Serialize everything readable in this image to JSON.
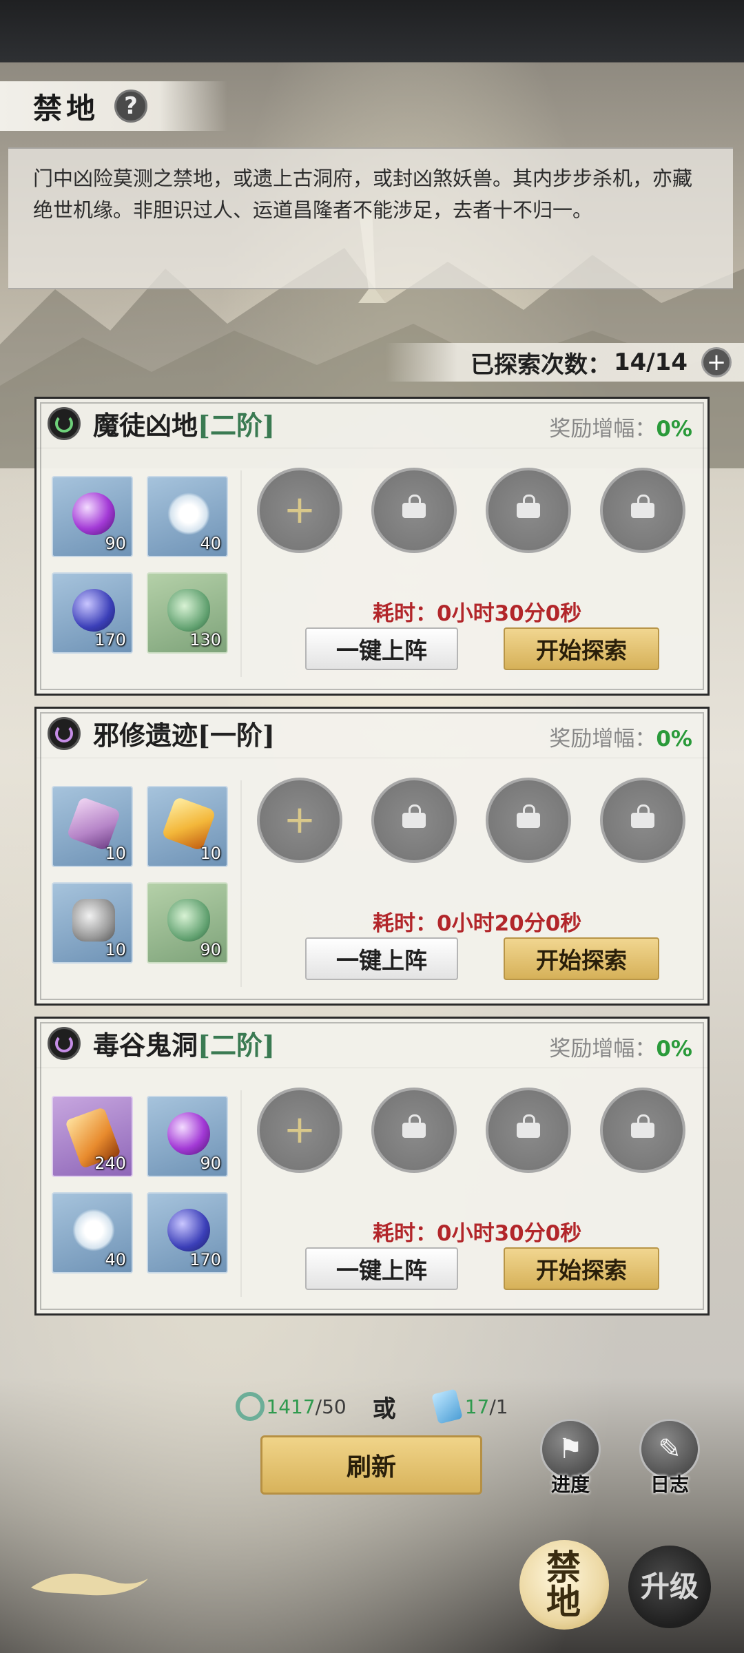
{
  "header": {
    "title": "禁地",
    "help_icon": "?"
  },
  "description": "门中凶险莫测之禁地，或遗上古洞府，或封凶煞妖兽。其内步步杀机，亦藏绝世机缘。非胆识过人、运道昌隆者不能涉足，去者十不归一。",
  "explore_count": {
    "label": "已探索次数：",
    "value": "14/14",
    "plus": "+"
  },
  "zones": [
    {
      "name": "魔徒凶地",
      "tier": "[二阶]",
      "icon": "green-swirl-icon",
      "bonus_label": "奖励增幅：",
      "bonus_value": "0%",
      "items": [
        {
          "icon": "purple-orb",
          "qty": "90"
        },
        {
          "icon": "white-flower",
          "qty": "40"
        },
        {
          "icon": "blue-berries",
          "qty": "170"
        },
        {
          "icon": "jade-gourd",
          "qty": "130"
        }
      ],
      "time_label": "耗时：",
      "time_value": "0小时30分0秒",
      "quick_button": "一键上阵",
      "start_button": "开始探索"
    },
    {
      "name": "邪修遗迹",
      "tier": "[一阶]",
      "icon": "purple-swirl-icon",
      "bonus_label": "奖励增幅：",
      "bonus_value": "0%",
      "items": [
        {
          "icon": "purple-crystal",
          "qty": "10"
        },
        {
          "icon": "fire-crystal",
          "qty": "10"
        },
        {
          "icon": "grey-stone",
          "qty": "10"
        },
        {
          "icon": "jade-gourd",
          "qty": "90"
        }
      ],
      "time_label": "耗时：",
      "time_value": "0小时20分0秒",
      "quick_button": "一键上阵",
      "start_button": "开始探索"
    },
    {
      "name": "毒谷鬼洞",
      "tier": "[二阶]",
      "icon": "purple-swirl-icon",
      "bonus_label": "奖励增幅：",
      "bonus_value": "0%",
      "items": [
        {
          "icon": "amber-shard",
          "qty": "240"
        },
        {
          "icon": "purple-orb",
          "qty": "90"
        },
        {
          "icon": "white-flower",
          "qty": "40"
        },
        {
          "icon": "blue-berries",
          "qty": "170"
        }
      ],
      "time_label": "耗时：",
      "time_value": "0小时30分0秒",
      "quick_button": "一键上阵",
      "start_button": "开始探索"
    }
  ],
  "refresh_cost": {
    "jade_have": "1417",
    "jade_need": "/50",
    "or": "或",
    "ticket_have": "17",
    "ticket_need": "/1"
  },
  "refresh_button": "刷新",
  "side_buttons": {
    "progress": "进度",
    "log": "日志"
  },
  "bottom_nav": {
    "forbidden": "禁地",
    "upgrade": "升级"
  },
  "colors": {
    "accent_gold": "#d8b35b",
    "time_red": "#b2262a",
    "bonus_green": "#2a9a3a",
    "tier_green": "#3a7a52"
  }
}
